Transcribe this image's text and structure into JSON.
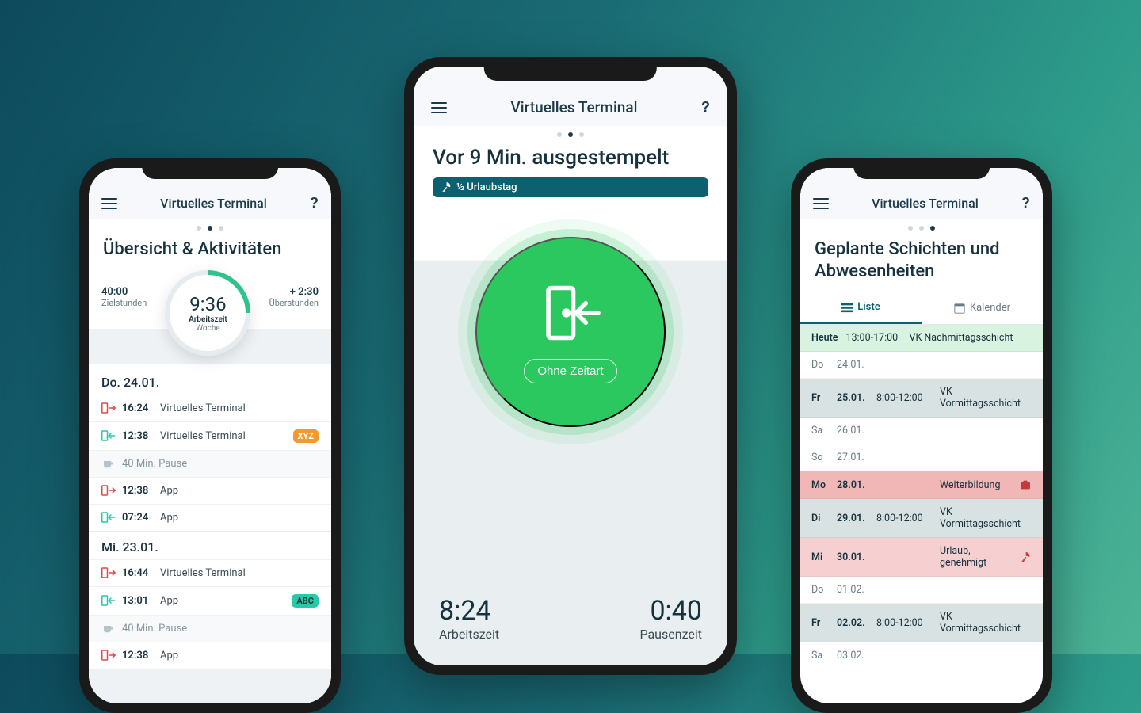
{
  "app_title": "Virtuelles Terminal",
  "help_glyph": "?",
  "left": {
    "dots_active": 1,
    "title": "Übersicht & Aktivitäten",
    "target": {
      "value": "40:00",
      "label": "Zielstunden"
    },
    "overtime": {
      "value": "+ 2:30",
      "label": "Überstunden"
    },
    "ring": {
      "big": "9:36",
      "mid": "Arbeitszeit",
      "small": "Woche"
    },
    "days": [
      {
        "header": "Do. 24.01.",
        "entries": [
          {
            "kind": "out",
            "time": "16:24",
            "label": "Virtuelles Terminal"
          },
          {
            "kind": "in",
            "time": "12:38",
            "label": "Virtuelles Terminal",
            "badge": {
              "text": "XYZ",
              "style": "orange"
            }
          },
          {
            "kind": "pause",
            "label": "40 Min. Pause"
          },
          {
            "kind": "out",
            "time": "12:38",
            "label": "App"
          },
          {
            "kind": "in",
            "time": "07:24",
            "label": "App"
          }
        ]
      },
      {
        "header": "Mi. 23.01.",
        "entries": [
          {
            "kind": "out",
            "time": "16:44",
            "label": "Virtuelles Terminal"
          },
          {
            "kind": "in",
            "time": "13:01",
            "label": "App",
            "badge": {
              "text": "ABC",
              "style": "teal"
            }
          },
          {
            "kind": "pause",
            "label": "40 Min. Pause"
          },
          {
            "kind": "out",
            "time": "12:38",
            "label": "App"
          }
        ]
      }
    ]
  },
  "center": {
    "dots_active": 1,
    "title_line": "Vor 9 Min. ausgestempelt",
    "chip": "½ Urlaubstag",
    "pill": "Ohne Zeitart",
    "work": {
      "value": "8:24",
      "label": "Arbeitszeit"
    },
    "pause": {
      "value": "0:40",
      "label": "Pausenzeit"
    }
  },
  "right": {
    "dots_active": 2,
    "title": "Geplante Schichten und Abwesenheiten",
    "tabs": {
      "list": "Liste",
      "calendar": "Kalender"
    },
    "rows": [
      {
        "color": "green",
        "weekday": "Heute",
        "date": "",
        "time": "13:00-17:00",
        "act": "VK Nachmittagsschicht"
      },
      {
        "color": "",
        "weekday": "Do",
        "date": "24.01.",
        "time": "",
        "act": ""
      },
      {
        "color": "grey",
        "weekday": "Fr",
        "date": "25.01.",
        "time": "8:00-12:00",
        "act": "VK Vormittagsschicht"
      },
      {
        "color": "",
        "weekday": "Sa",
        "date": "26.01.",
        "time": "",
        "act": ""
      },
      {
        "color": "",
        "weekday": "So",
        "date": "27.01.",
        "time": "",
        "act": ""
      },
      {
        "color": "red",
        "weekday": "Mo",
        "date": "28.01.",
        "time": "",
        "act": "Weiterbildung",
        "icon": "briefcase"
      },
      {
        "color": "grey",
        "weekday": "Di",
        "date": "29.01.",
        "time": "8:00-12:00",
        "act": "VK Vormittagsschicht"
      },
      {
        "color": "pink",
        "weekday": "Mi",
        "date": "30.01.",
        "time": "",
        "act": "Urlaub, genehmigt",
        "icon": "beach"
      },
      {
        "color": "",
        "weekday": "Do",
        "date": "01.02.",
        "time": "",
        "act": ""
      },
      {
        "color": "grey",
        "weekday": "Fr",
        "date": "02.02.",
        "time": "8:00-12:00",
        "act": "VK Vormittagsschicht"
      },
      {
        "color": "",
        "weekday": "Sa",
        "date": "03.02.",
        "time": "",
        "act": ""
      }
    ]
  }
}
